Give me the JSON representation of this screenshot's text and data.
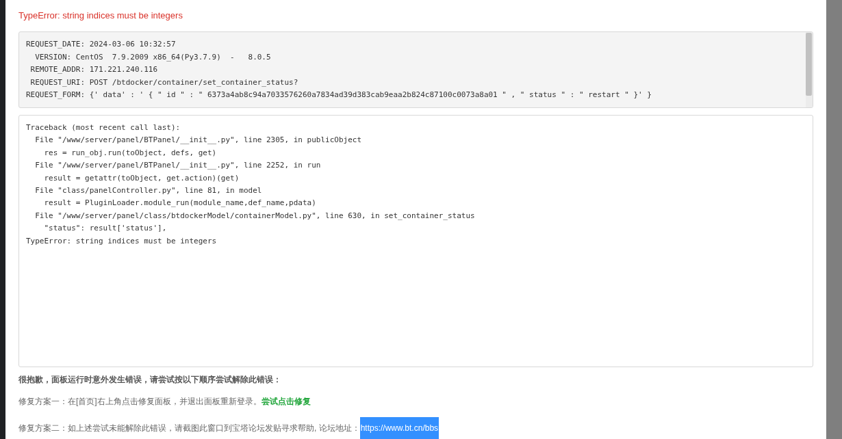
{
  "dialog": {
    "error_title": "TypeError: string indices must be integers",
    "request_info": [
      "REQUEST_DATE: 2024-03-06 10:32:57",
      "  VERSION: CentOS  7.9.2009 x86_64(Py3.7.9)  -   8.0.5",
      " REMOTE_ADDR: 171.221.240.116",
      " REQUEST_URI: POST /btdocker/container/set_container_status?",
      "REQUEST_FORM: {' data' : ' { \" id \" : \" 6373a4ab8c94a7033576260a7834ad39d383cab9eaa2b824c87100c0073a8a01 \" , \" status \" : \" restart \" }' }"
    ],
    "traceback": [
      "Traceback (most recent call last):",
      "  File \"/www/server/panel/BTPanel/__init__.py\", line 2305, in publicObject",
      "    res = run_obj.run(toObject, defs, get)",
      "  File \"/www/server/panel/BTPanel/__init__.py\", line 2252, in run",
      "    result = getattr(toObject, get.action)(get)",
      "  File \"class/panelController.py\", line 81, in model",
      "    result = PluginLoader.module_run(module_name,def_name,pdata)",
      "  File \"/www/server/panel/class/btdockerModel/containerModel.py\", line 630, in set_container_status",
      "    \"status\": result['status'],",
      "TypeError: string indices must be integers"
    ],
    "apology": "很抱歉，面板运行时意外发生错误，请尝试按以下顺序尝试解除此错误：",
    "fixes": [
      {
        "text": "修复方案一：在[首页]右上角点击修复面板，并退出面板重新登录。",
        "link": "尝试点击修复",
        "kind": "action",
        "selected": false
      },
      {
        "text": "修复方案二：如上述尝试未能解除此错误，请截图此窗口到宝塔论坛发贴寻求帮助, 论坛地址：",
        "link": "https://www.bt.cn/bbs",
        "kind": "url",
        "selected": true
      }
    ]
  }
}
